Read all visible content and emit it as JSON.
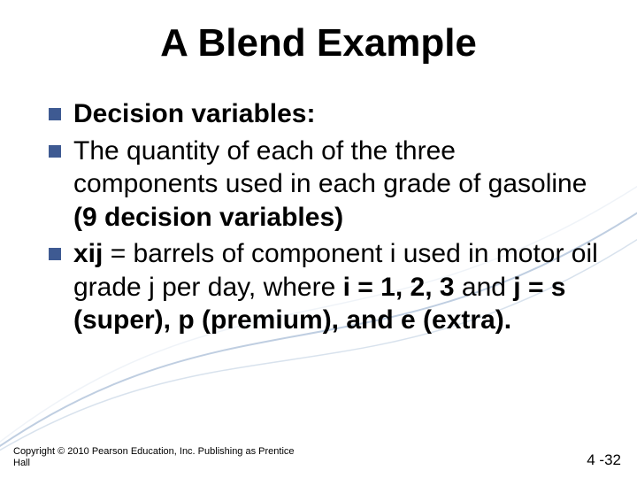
{
  "title": "A Blend Example",
  "bullets": {
    "b1_bold": "Decision variables:",
    "b2_pre": "The quantity of each of the three components used in each grade of gasoline ",
    "b2_bold": "(9 decision variables)",
    "b3_bold1": "xij",
    "b3_mid1": " = barrels of component i used in motor oil grade j per day, where ",
    "b3_bold2": "i = 1, 2, 3",
    "b3_mid2": " and ",
    "b3_bold3": "j = s (super), p (premium), and e (extra).",
    "b3_tail": ""
  },
  "footer": "Copyright © 2010 Pearson Education, Inc. Publishing as Prentice Hall",
  "pagenum": "4 -32"
}
